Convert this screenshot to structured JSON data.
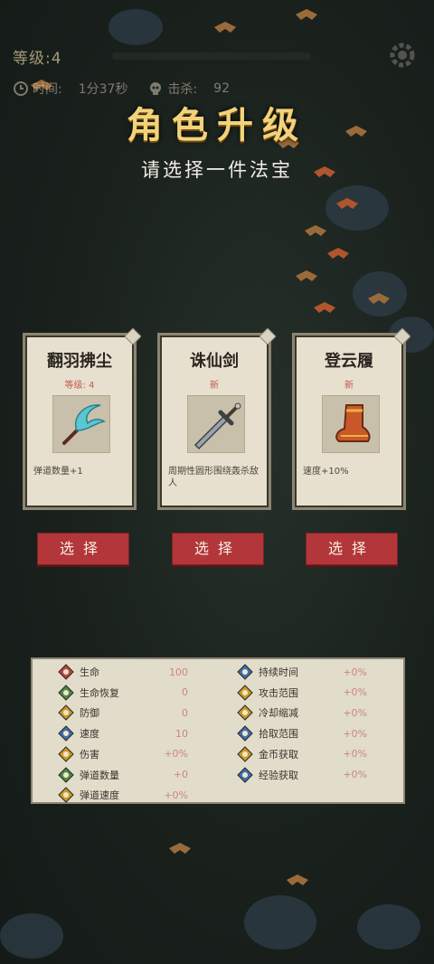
{
  "hud": {
    "level_label": "等级:4",
    "time_label": "时间:",
    "time_value": "1分37秒",
    "kills_label": "击杀:",
    "kills_value": "92"
  },
  "title": "角色升级",
  "subtitle": "请选择一件法宝",
  "cards": [
    {
      "name": "翻羽拂尘",
      "level": "等级: 4",
      "desc": "弹道数量+1",
      "icon": "whisk-icon"
    },
    {
      "name": "诛仙剑",
      "level": "新",
      "desc": "周期性圆形围绕轰杀敌人",
      "icon": "sword-icon"
    },
    {
      "name": "登云履",
      "level": "新",
      "desc": "速度+10%",
      "icon": "boot-icon"
    }
  ],
  "select_label": "选择",
  "stats_left": [
    {
      "name": "生命",
      "value": "100",
      "color": "#c0433d"
    },
    {
      "name": "生命恢复",
      "value": "0",
      "color": "#4d8a4a"
    },
    {
      "name": "防御",
      "value": "0",
      "color": "#c99a2b"
    },
    {
      "name": "速度",
      "value": "10",
      "color": "#3e6fb3"
    },
    {
      "name": "伤害",
      "value": "+0%",
      "color": "#c99a2b"
    },
    {
      "name": "弹道数量",
      "value": "+0",
      "color": "#4d8a4a"
    },
    {
      "name": "弹道速度",
      "value": "+0%",
      "color": "#c99a2b"
    }
  ],
  "stats_right": [
    {
      "name": "持续时间",
      "value": "+0%",
      "color": "#3e6fb3"
    },
    {
      "name": "攻击范围",
      "value": "+0%",
      "color": "#c99a2b"
    },
    {
      "name": "冷却缩减",
      "value": "+0%",
      "color": "#c99a2b"
    },
    {
      "name": "拾取范围",
      "value": "+0%",
      "color": "#3e6fb3"
    },
    {
      "name": "金币获取",
      "value": "+0%",
      "color": "#c99a2b"
    },
    {
      "name": "经验获取",
      "value": "+0%",
      "color": "#3e6fb3"
    }
  ]
}
